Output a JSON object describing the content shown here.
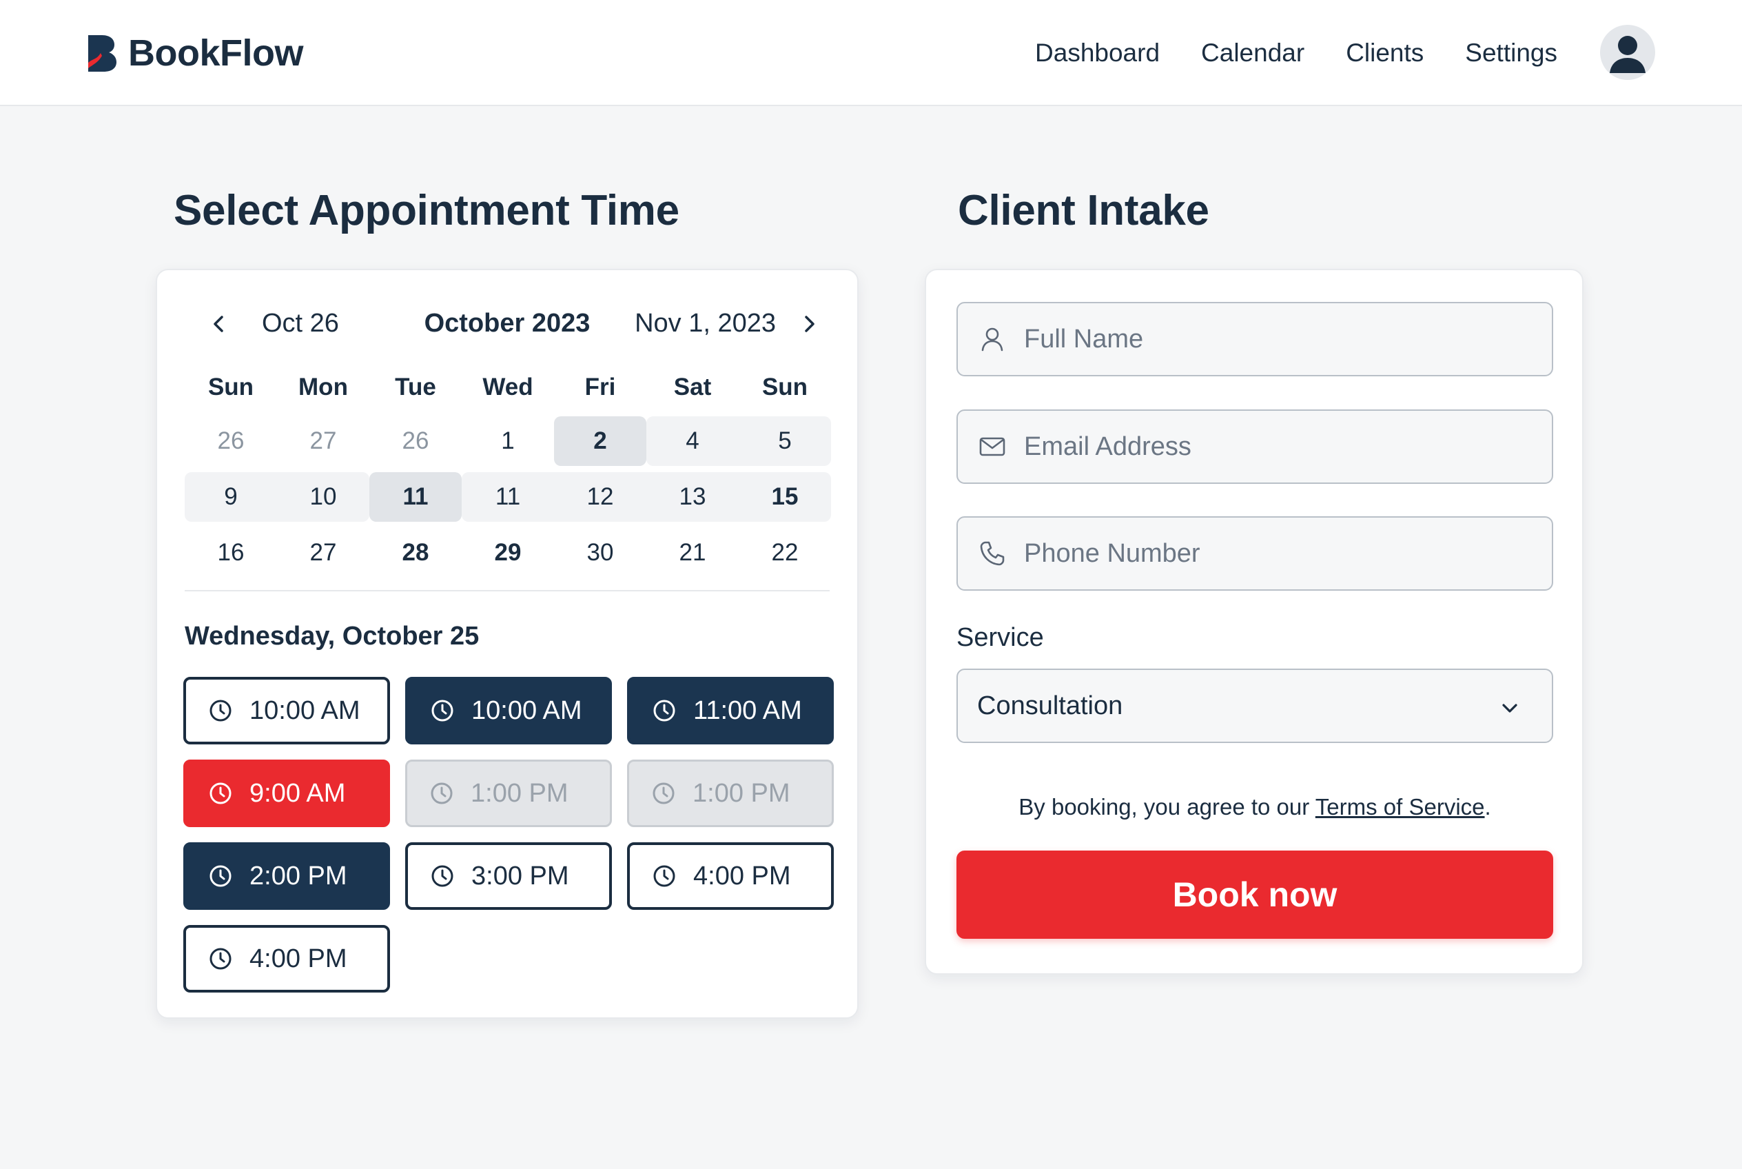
{
  "app": {
    "name": "BookFlow",
    "accent_color": "#ea2a2f",
    "primary_color": "#1b2d40"
  },
  "nav": {
    "items": [
      "Dashboard",
      "Calendar",
      "Clients",
      "Settings"
    ]
  },
  "user": {
    "avatar_icon": "user-avatar-icon"
  },
  "appointment": {
    "title": "Select Appointment Time",
    "calendar": {
      "prev_label": "Oct 26",
      "month_label": "October 2023",
      "next_label": "Nov 1, 2023",
      "weekdays": [
        "Sun",
        "Mon",
        "Tue",
        "Wed",
        "Fri",
        "Sat",
        "Sun"
      ],
      "weeks": [
        [
          {
            "label": "26",
            "muted": true
          },
          {
            "label": "27",
            "muted": true
          },
          {
            "label": "26",
            "muted": true
          },
          {
            "label": "1"
          },
          {
            "label": "2",
            "selected": true
          },
          {
            "label": "4",
            "highlighted": true
          },
          {
            "label": "5",
            "highlighted": true
          }
        ],
        [
          {
            "label": "9",
            "highlighted": true
          },
          {
            "label": "10",
            "highlighted": true
          },
          {
            "label": "11",
            "selected": true
          },
          {
            "label": "11",
            "highlighted": true
          },
          {
            "label": "12",
            "highlighted": true
          },
          {
            "label": "13",
            "highlighted": true
          },
          {
            "label": "15",
            "highlighted": true,
            "bold": true
          }
        ],
        [
          {
            "label": "16"
          },
          {
            "label": "27"
          },
          {
            "label": "28",
            "bold": true
          },
          {
            "label": "29",
            "bold": true
          },
          {
            "label": "30"
          },
          {
            "label": "21"
          },
          {
            "label": "22"
          }
        ]
      ]
    },
    "selected_day_title": "Wednesday, October 25",
    "time_slots": [
      {
        "label": "10:00 AM",
        "state": "available"
      },
      {
        "label": "10:00 AM",
        "state": "booked"
      },
      {
        "label": "11:00 AM",
        "state": "booked"
      },
      {
        "label": "9:00 AM",
        "state": "selected"
      },
      {
        "label": "1:00 PM",
        "state": "unavailable"
      },
      {
        "label": "1:00 PM",
        "state": "unavailable"
      },
      {
        "label": "2:00 PM",
        "state": "booked"
      },
      {
        "label": "3:00 PM",
        "state": "available"
      },
      {
        "label": "4:00 PM",
        "state": "available"
      },
      {
        "label": "4:00 PM",
        "state": "available"
      }
    ]
  },
  "intake": {
    "title": "Client Intake",
    "full_name": {
      "placeholder": "Full Name",
      "value": ""
    },
    "email": {
      "placeholder": "Email Address",
      "value": ""
    },
    "phone": {
      "placeholder": "Phone Number",
      "value": ""
    },
    "service_label": "Service",
    "service_value": "Consultation",
    "terms_prefix": "By booking, you agree to our ",
    "terms_link": "Terms of Service",
    "terms_suffix": ".",
    "book_label": "Book now"
  }
}
